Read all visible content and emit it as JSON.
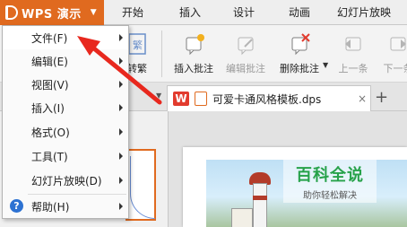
{
  "app": {
    "title": "WPS 演示",
    "accent": "#e06a1f"
  },
  "tabs": [
    {
      "label": "开始"
    },
    {
      "label": "插入"
    },
    {
      "label": "设计"
    },
    {
      "label": "动画"
    },
    {
      "label": "幻灯片放映"
    }
  ],
  "toolbar": {
    "partial_label": "转繁",
    "items": [
      {
        "label": "插入批注",
        "icon": "insert-comment-icon",
        "enabled": true
      },
      {
        "label": "编辑批注",
        "icon": "edit-comment-icon",
        "enabled": false
      },
      {
        "label": "删除批注",
        "icon": "delete-comment-icon",
        "enabled": true
      },
      {
        "label": "上一条",
        "icon": "previous-icon",
        "enabled": false
      },
      {
        "label": "下一条",
        "icon": "next-icon",
        "enabled": false
      }
    ]
  },
  "document": {
    "tab_name": "可爱卡通风格模板.dps",
    "close_symbol": "×",
    "new_tab_symbol": "+"
  },
  "menu": {
    "items": [
      {
        "label": "文件(F)",
        "has_submenu": true
      },
      {
        "label": "编辑(E)",
        "has_submenu": true
      },
      {
        "label": "视图(V)",
        "has_submenu": true
      },
      {
        "label": "插入(I)",
        "has_submenu": true
      },
      {
        "label": "格式(O)",
        "has_submenu": true
      },
      {
        "label": "工具(T)",
        "has_submenu": true
      },
      {
        "label": "幻灯片放映(D)",
        "has_submenu": true
      },
      {
        "label": "帮助(H)",
        "has_submenu": true
      }
    ]
  },
  "watermark": {
    "title": "百科全说",
    "subtitle": "助你轻松解决"
  },
  "colors": {
    "annotation_arrow": "#e8281e",
    "watermark_green": "#27a24a"
  }
}
